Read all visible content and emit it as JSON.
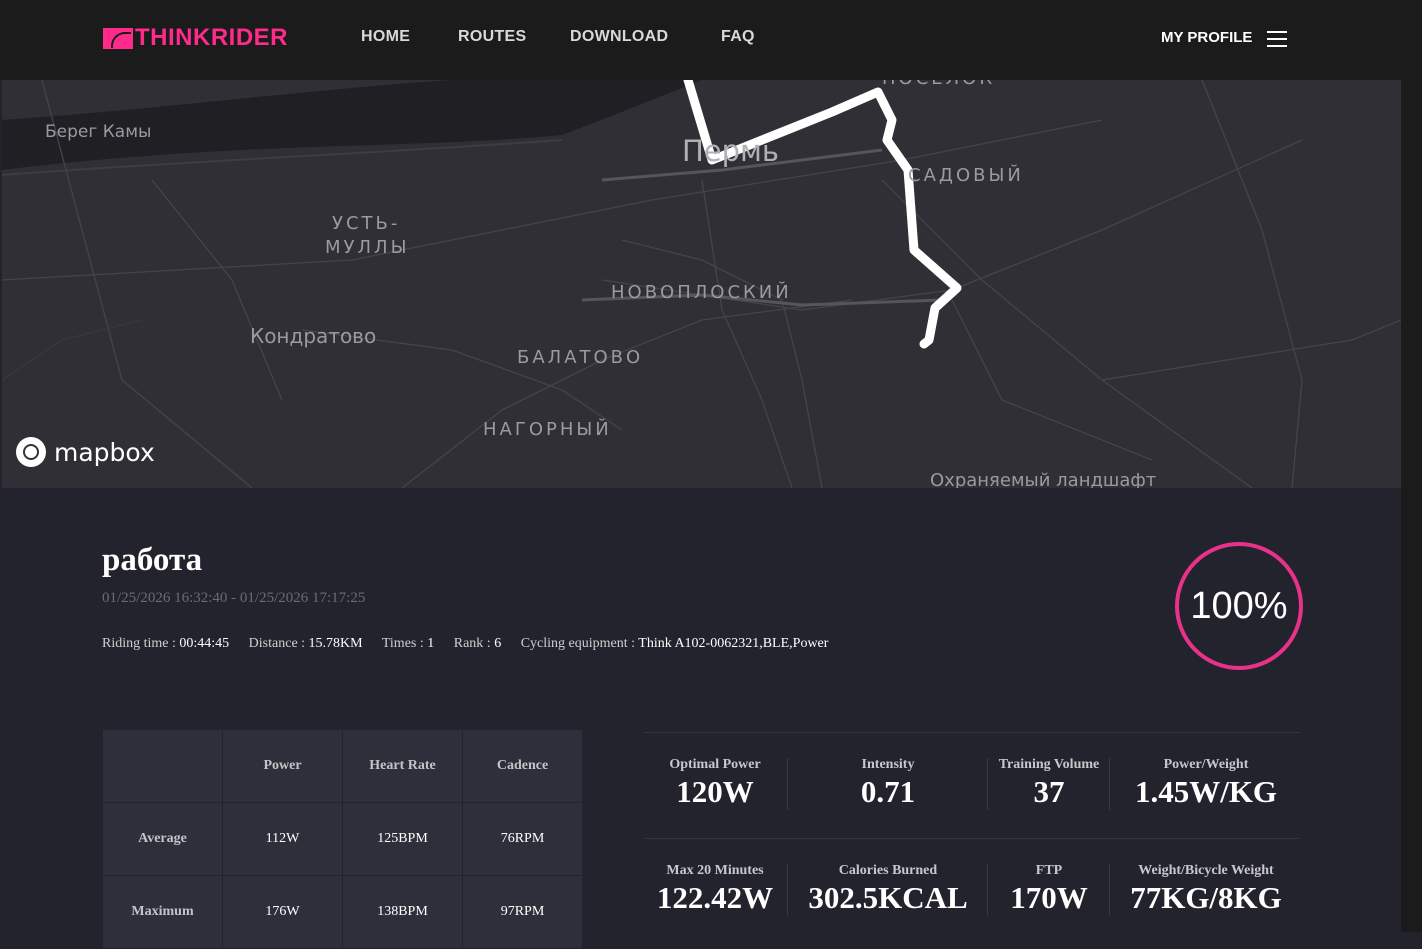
{
  "header": {
    "logo_text": "THINKRIDER",
    "nav": [
      "HOME",
      "ROUTES",
      "DOWNLOAD",
      "FAQ"
    ],
    "profile_label": "MY PROFILE"
  },
  "map": {
    "labels": [
      "Берег Камы",
      "УСТЬ-",
      "МУЛЛЫ",
      "Кондратово",
      "Пермь",
      "САДОВЫЙ",
      "НОВОПЛОСКИЙ",
      "БАЛАТОВО",
      "НАГОРНЫЙ",
      "ПОСЕЛОК",
      "Охраняемый ландшафт"
    ],
    "attribution": "mapbox"
  },
  "ride": {
    "title": "работа",
    "date_range": "01/25/2026 16:32:40 - 01/25/2026 17:17:25",
    "riding_time_label": "Riding time : ",
    "riding_time": "00:44:45",
    "distance_label": "Distance : ",
    "distance": "15.78KM",
    "times_label": "Times : ",
    "times": "1",
    "rank_label": "Rank : ",
    "rank": "6",
    "equipment_label": "Cycling equipment : ",
    "equipment": "Think A102-0062321,BLE,Power",
    "completion": "100%"
  },
  "table": {
    "headers": [
      "",
      "Power",
      "Heart Rate",
      "Cadence"
    ],
    "rows": [
      [
        "Average",
        "112W",
        "125BPM",
        "76RPM"
      ],
      [
        "Maximum",
        "176W",
        "138BPM",
        "97RPM"
      ]
    ]
  },
  "stats": [
    {
      "label": "Optimal Power",
      "value": "120W"
    },
    {
      "label": "Intensity",
      "value": "0.71"
    },
    {
      "label": "Training Volume",
      "value": "37"
    },
    {
      "label": "Power/Weight",
      "value": "1.45W/KG"
    },
    {
      "label": "Max 20 Minutes",
      "value": "122.42W"
    },
    {
      "label": "Calories Burned",
      "value": "302.5KCAL"
    },
    {
      "label": "FTP",
      "value": "170W"
    },
    {
      "label": "Weight/Bicycle Weight",
      "value": "77KG/8KG"
    }
  ],
  "colors": {
    "accent": "#e8328a",
    "logo": "#ff2a8a",
    "background": "#23232d",
    "header": "#1b1b1b"
  }
}
